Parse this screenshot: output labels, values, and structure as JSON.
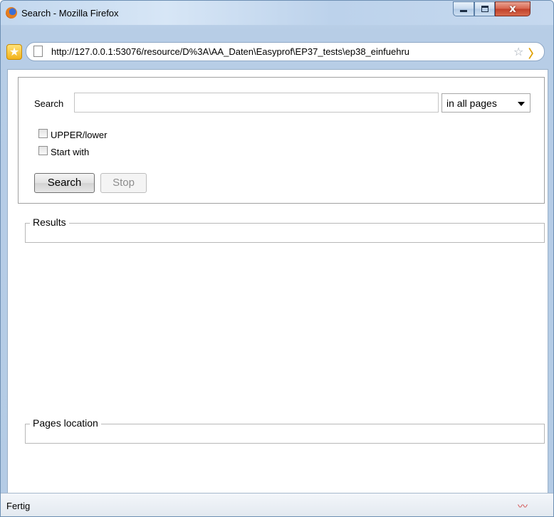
{
  "window": {
    "title": "Search - Mozilla Firefox",
    "controls": {
      "minimize": "minimize-icon",
      "maximize": "maximize-icon",
      "close": "x"
    }
  },
  "addressbar": {
    "url": "http://127.0.0.1:53076/resource/D%3A\\AA_Daten\\Easyprof\\EP37_tests\\ep38_einfuehru"
  },
  "search": {
    "label": "Search",
    "input_value": "",
    "scope_selected": "in all pages",
    "options": [
      {
        "label": "UPPER/lower",
        "checked": false
      },
      {
        "label": "Start with",
        "checked": false
      }
    ],
    "search_button": "Search",
    "stop_button": "Stop"
  },
  "results": {
    "legend": "Results"
  },
  "pages_location": {
    "legend": "Pages location"
  },
  "statusbar": {
    "text": "Fertig"
  },
  "colors": {
    "frame": "#b4cbe5",
    "close_button": "#c0402a"
  }
}
